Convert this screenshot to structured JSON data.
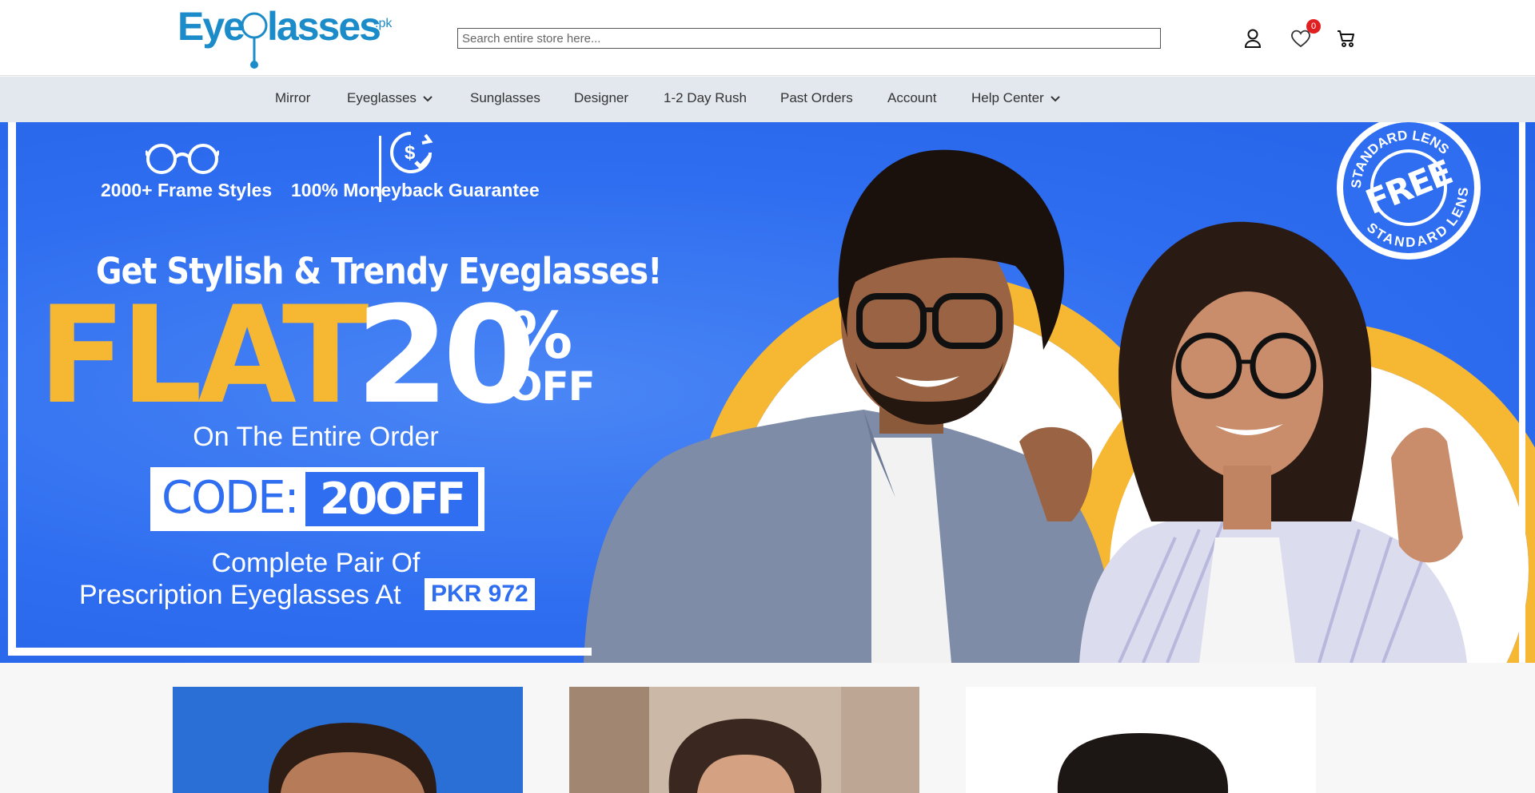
{
  "header": {
    "logo_text": "Eyeglasses",
    "logo_suffix": ".pk",
    "search_placeholder": "Search entire store here...",
    "wishlist_count": "0",
    "icons": [
      "account-icon",
      "heart-icon",
      "cart-icon"
    ]
  },
  "nav": {
    "items": [
      {
        "label": "Mirror",
        "has_dropdown": false
      },
      {
        "label": "Eyeglasses",
        "has_dropdown": true
      },
      {
        "label": "Sunglasses",
        "has_dropdown": false
      },
      {
        "label": "Designer",
        "has_dropdown": false
      },
      {
        "label": "1-2 Day Rush",
        "has_dropdown": false
      },
      {
        "label": "Past Orders",
        "has_dropdown": false
      },
      {
        "label": "Account",
        "has_dropdown": false
      },
      {
        "label": "Help Center",
        "has_dropdown": true
      }
    ]
  },
  "hero": {
    "feature1": "2000+ Frame Styles",
    "feature2": "100% Moneyback Guarantee",
    "headline": "Get Stylish & Trendy Eyeglasses!",
    "flat": "FLAT",
    "discount_number": "20",
    "discount_pct": "%",
    "discount_off": "OFF",
    "entire_order": "On The Entire Order",
    "code_label": "CODE:",
    "code_value": "20OFF",
    "complete_line1": "Complete Pair Of",
    "complete_line2": "Prescription Eyeglasses At",
    "price": "PKR 972",
    "stamp_top": "STANDARD LENS",
    "stamp_center": "FREE",
    "stamp_bottom": "STANDARD LENS",
    "colors": {
      "blue": "#2f6ef0",
      "yellow": "#f6b733",
      "white": "#ffffff"
    }
  },
  "cards": [
    {
      "name": "card-men"
    },
    {
      "name": "card-women"
    },
    {
      "name": "card-kids"
    }
  ]
}
